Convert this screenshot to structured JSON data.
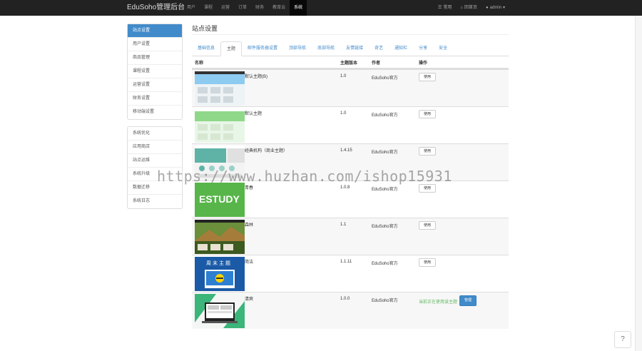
{
  "app": {
    "brand": "EduSoho管理后台"
  },
  "nav": [
    {
      "label": "用户",
      "active": false
    },
    {
      "label": "课程",
      "active": false
    },
    {
      "label": "运营",
      "active": false
    },
    {
      "label": "订单",
      "active": false
    },
    {
      "label": "财务",
      "active": false
    },
    {
      "label": "教育云",
      "active": false
    },
    {
      "label": "系统",
      "active": true
    }
  ],
  "topright": {
    "common": "常用",
    "home": "回首页",
    "user": "admin"
  },
  "sidebar": {
    "group1": [
      "站点设置",
      "用户设置",
      "商品管理",
      "课程设置",
      "运营设置",
      "财务设置",
      "移动端设置"
    ],
    "group2": [
      "系统优化",
      "应用商店",
      "站点运维",
      "系统升级",
      "数据迁移",
      "系统日志"
    ]
  },
  "page": {
    "title": "站点设置"
  },
  "tabs": [
    "基础信息",
    "主题",
    "邮件服务器设置",
    "顶部导航",
    "底部导航",
    "友情链接",
    "奇艺",
    "通知栏",
    "分享",
    "安全"
  ],
  "table": {
    "headers": [
      "名称",
      "主题版本",
      "作者",
      "操作"
    ],
    "rows": [
      {
        "name": "默认主题(B)",
        "version": "1.0",
        "author": "EduSoho官方",
        "action": "使用"
      },
      {
        "name": "默认主题",
        "version": "1.0",
        "author": "EduSoho官方",
        "action": "使用"
      },
      {
        "name": "经典机构（商业主题）",
        "version": "1.4.15",
        "author": "EduSoho官方",
        "action": "使用"
      },
      {
        "name": "青春",
        "version": "1.0.8",
        "author": "EduSoho官方",
        "action": "使用"
      },
      {
        "name": "森林",
        "version": "1.1",
        "author": "EduSoho官方",
        "action": "使用"
      },
      {
        "name": "简洁",
        "version": "1.1.11",
        "author": "EduSoho官方",
        "action": "使用"
      },
      {
        "name": "清爽",
        "version": "1.0.0",
        "author": "EduSoho官方",
        "status": "当前正在使用该主题",
        "action": "管理"
      }
    ],
    "thumb_text": [
      "ESTUDY",
      "周末主题"
    ]
  },
  "watermark": "https://www.huzhan.com/ishop15931",
  "help": "?",
  "colors": {
    "accent": "#428bca",
    "topbar": "#222222",
    "success": "#5cb85c"
  }
}
